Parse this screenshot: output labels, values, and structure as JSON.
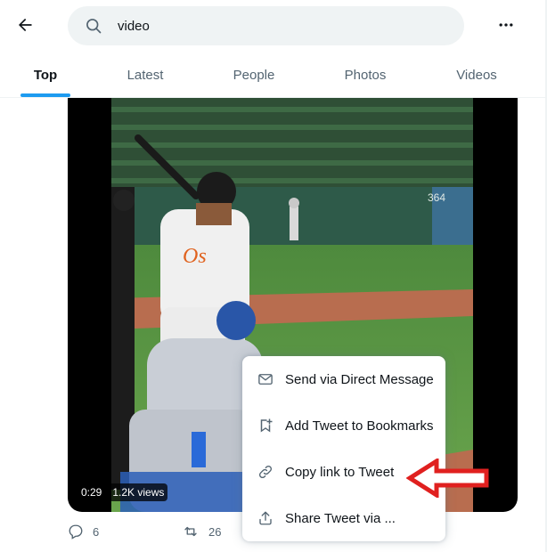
{
  "search": {
    "value": "video"
  },
  "tabs": [
    {
      "label": "Top",
      "active": true
    },
    {
      "label": "Latest"
    },
    {
      "label": "People"
    },
    {
      "label": "Photos"
    },
    {
      "label": "Videos"
    }
  ],
  "video": {
    "duration": "0:29",
    "views": "1.2K views"
  },
  "tweet_actions": {
    "replies": "6",
    "retweets": "26"
  },
  "context_menu": {
    "items": [
      {
        "label": "Send via Direct Message",
        "icon": "envelope-icon"
      },
      {
        "label": "Add Tweet to Bookmarks",
        "icon": "bookmark-add-icon"
      },
      {
        "label": "Copy link to Tweet",
        "icon": "link-icon"
      },
      {
        "label": "Share Tweet via ...",
        "icon": "share-icon"
      }
    ]
  },
  "colors": {
    "accent": "#1d9bf0",
    "annotation_arrow": "#e0201f",
    "text_secondary": "#536471"
  }
}
